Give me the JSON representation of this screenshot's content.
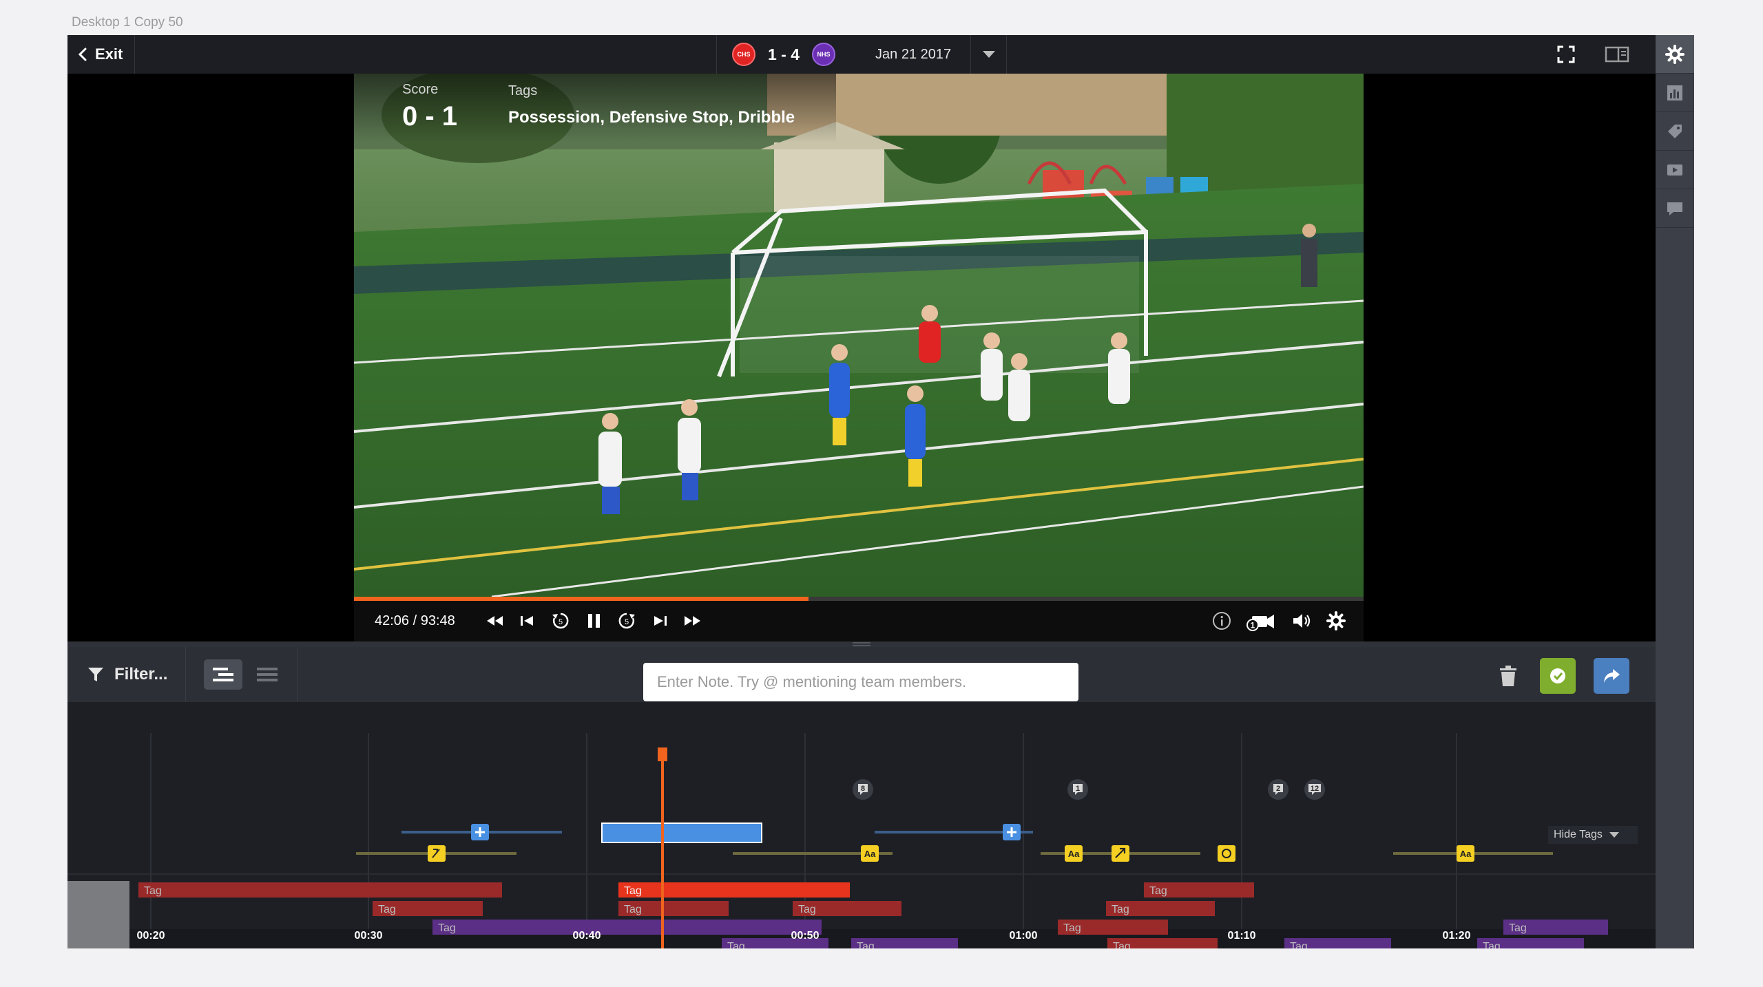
{
  "artboard_label": "Desktop 1 Copy 50",
  "header": {
    "exit_label": "Exit",
    "home_team_abbr": "CHS",
    "away_team_abbr": "NHS",
    "score": "1 - 4",
    "date": "Jan 21 2017"
  },
  "video": {
    "overlay": {
      "score_label": "Score",
      "score_value": "0 - 1",
      "tags_label": "Tags",
      "tags_value": "Possession, Defensive Stop, Dribble"
    },
    "timecode": "42:06 / 93:48",
    "progress_fraction": 0.45,
    "angle_badge": "1"
  },
  "toolbar": {
    "filter_label": "Filter...",
    "note_placeholder": "Enter Note. Try @ mentioning team members."
  },
  "timeline": {
    "hide_tags_label": "Hide Tags",
    "time_labels": [
      "00:20",
      "00:30",
      "00:40",
      "00:50",
      "01:00",
      "01:10",
      "01:20"
    ],
    "comment_badges": [
      "8",
      "1",
      "2",
      "12"
    ],
    "marker_labels": [
      "Aa",
      "Aa",
      "Aa",
      "Aa"
    ],
    "tag_text": "Tag",
    "colors": {
      "tag_dark_red": "#9a2a2a",
      "tag_bright_red": "#e8341c",
      "tag_purple": "#5b2f86",
      "clip_blue": "#4a90e2",
      "playhead": "#f0641e",
      "marker_yellow": "#f5d023"
    },
    "icons": [
      "plus-icon",
      "annotation-icon",
      "text-icon",
      "arrow-icon",
      "circle-icon"
    ]
  },
  "rail": {
    "icons": [
      "gear-icon",
      "stats-icon",
      "tag-icon",
      "playlist-icon",
      "comment-icon"
    ]
  }
}
